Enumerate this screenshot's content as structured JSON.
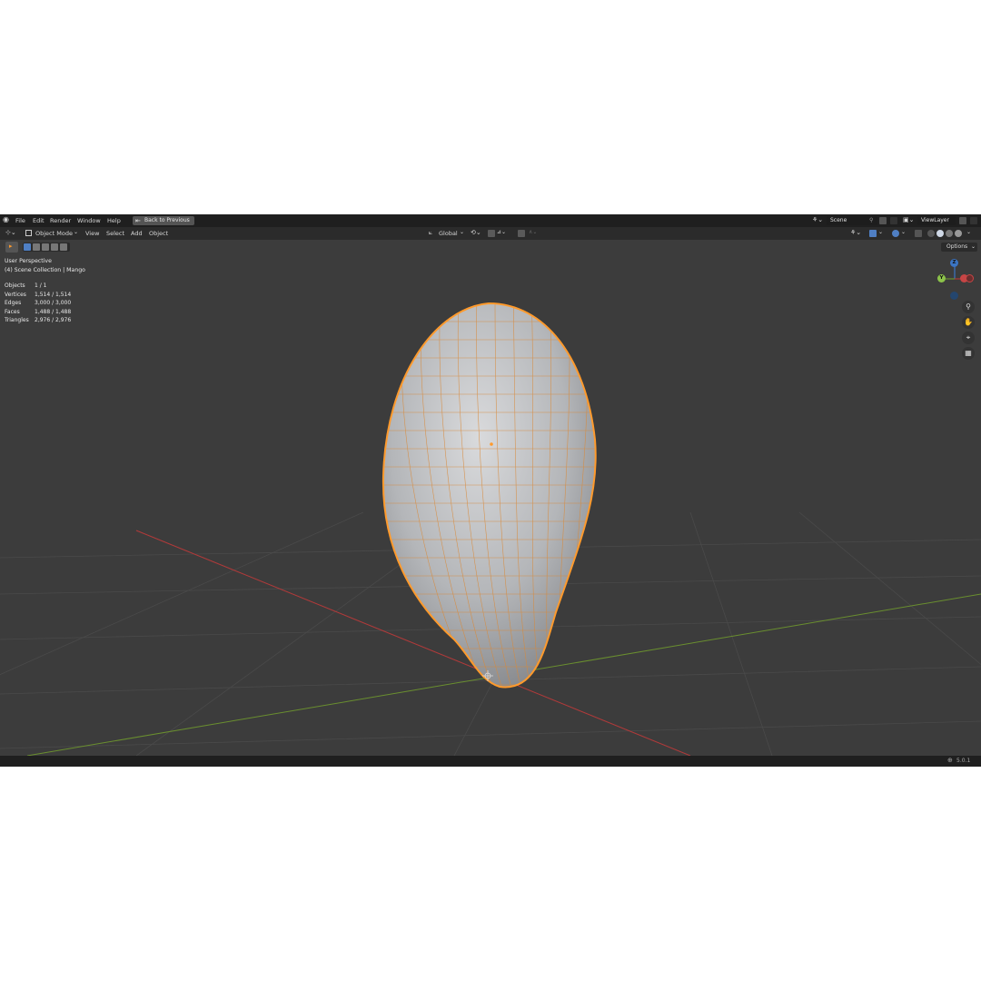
{
  "menubar": {
    "items": [
      "File",
      "Edit",
      "Render",
      "Window",
      "Help"
    ],
    "back_label": "Back to Previous",
    "scene_value": "Scene",
    "view_layer_value": "ViewLayer"
  },
  "header": {
    "mode_label": "Object Mode",
    "menus": [
      "View",
      "Select",
      "Add",
      "Object"
    ],
    "transform_orientation": "Global",
    "options_label": "Options"
  },
  "viewport": {
    "perspective_label": "User Perspective",
    "collection_label": "(4) Scene Collection | Mango",
    "stats": [
      {
        "label": "Objects",
        "value": "1 / 1"
      },
      {
        "label": "Vertices",
        "value": "1,514 / 1,514"
      },
      {
        "label": "Edges",
        "value": "3,000 / 3,000"
      },
      {
        "label": "Faces",
        "value": "1,488 / 1,488"
      },
      {
        "label": "Triangles",
        "value": "2,976 / 2,976"
      }
    ],
    "gizmo": {
      "z": "Z",
      "y": "Y",
      "x": ""
    },
    "nav_icons": [
      "zoom-icon",
      "hand-pan-icon",
      "camera-icon",
      "grid-perspective-icon"
    ]
  },
  "statusbar": {
    "version": "5.0.1"
  },
  "colors": {
    "accent": "#ff9a2c",
    "x_axis": "#b13a3a",
    "y_axis": "#6a8f2f",
    "z_axis": "#3b75c4"
  }
}
